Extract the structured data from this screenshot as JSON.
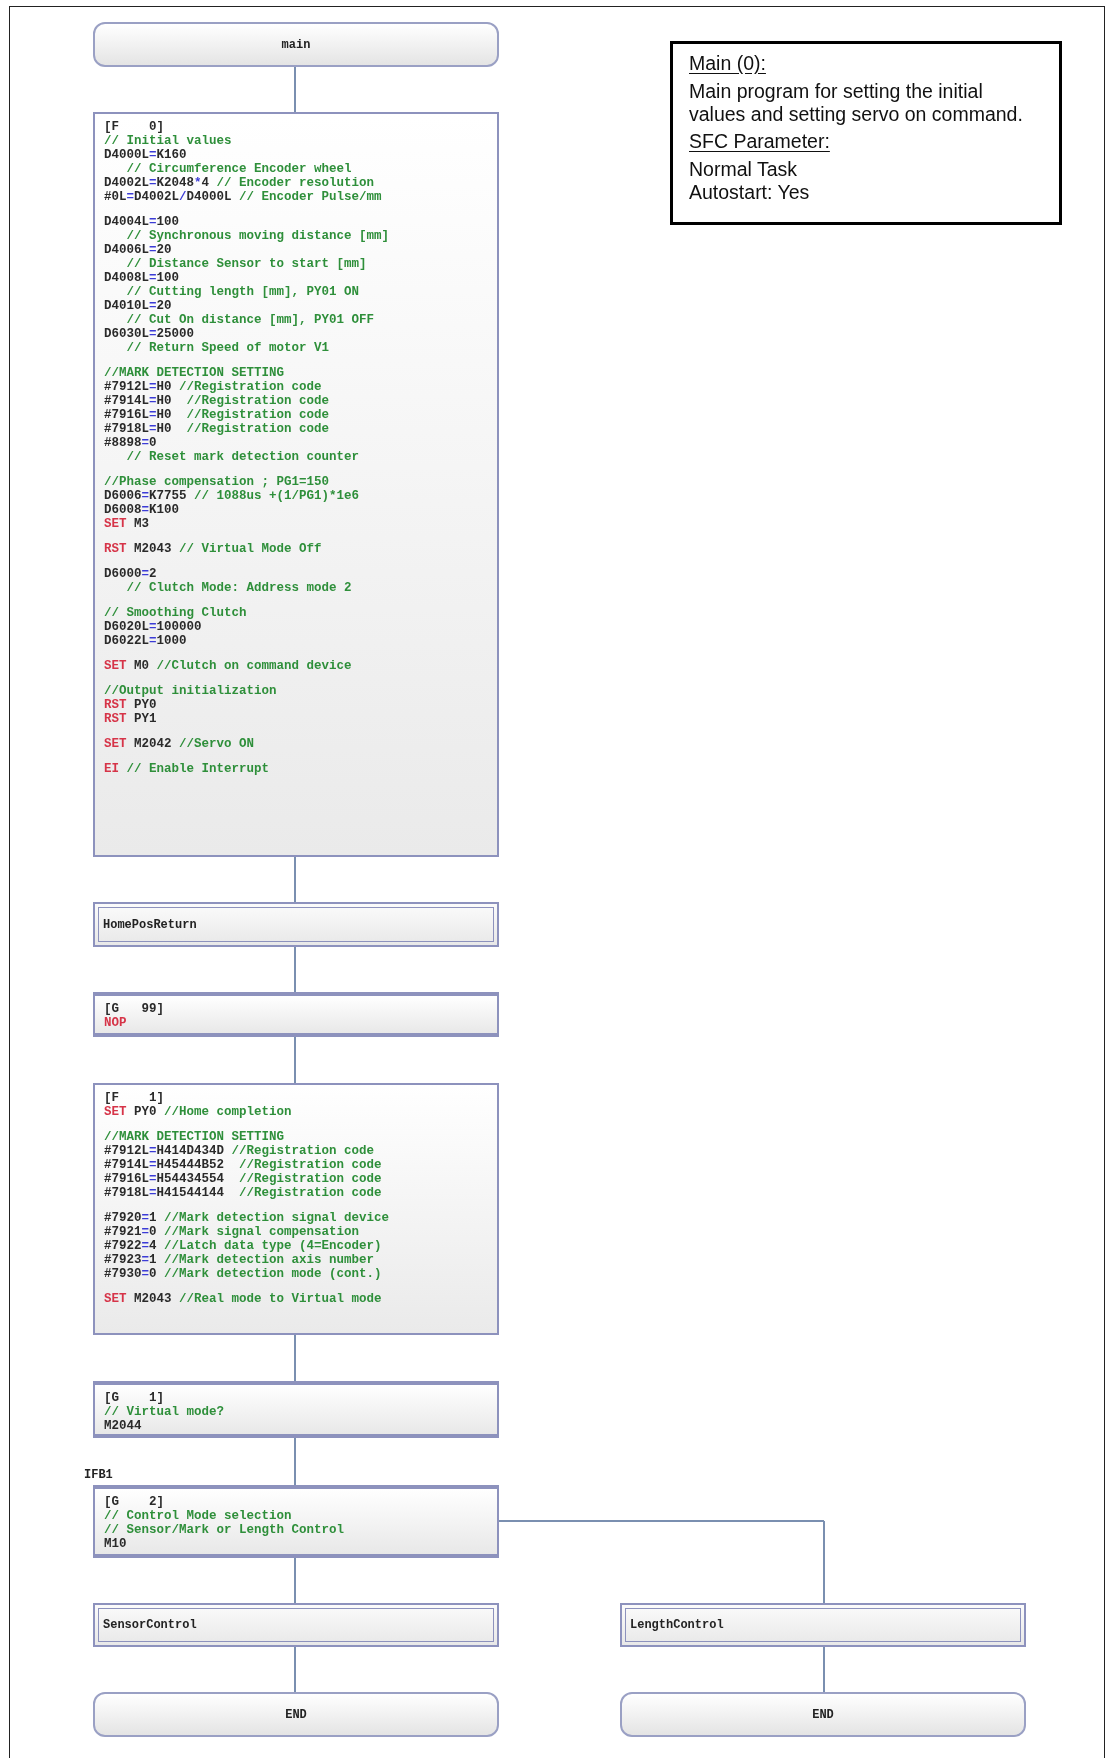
{
  "note": {
    "heading": "Main (0):",
    "description": "Main program for setting the initial values and setting servo on command.",
    "param_heading": "SFC Parameter:",
    "params": [
      "Normal Task",
      "Autostart: Yes"
    ]
  },
  "main_flow": [
    {
      "kind": "terminal",
      "label": "main"
    },
    {
      "kind": "block",
      "paragraphs": [
        [
          [
            {
              "kind": "device",
              "text": "[F    0]"
            }
          ],
          [
            {
              "kind": "comment",
              "text": "// Initial values"
            }
          ],
          [
            {
              "kind": "device",
              "text": "D4000L"
            },
            {
              "kind": "operator",
              "text": "="
            },
            {
              "kind": "device",
              "text": "K160"
            }
          ],
          [
            {
              "kind": "comment",
              "text": "   // Circumference Encoder wheel"
            }
          ],
          [
            {
              "kind": "device",
              "text": "D4002L"
            },
            {
              "kind": "operator",
              "text": "="
            },
            {
              "kind": "device",
              "text": "K2048"
            },
            {
              "kind": "operator",
              "text": "*"
            },
            {
              "kind": "device",
              "text": "4 "
            },
            {
              "kind": "comment",
              "text": "// Encoder resolution"
            }
          ],
          [
            {
              "kind": "device",
              "text": "#0L"
            },
            {
              "kind": "operator",
              "text": "="
            },
            {
              "kind": "device",
              "text": "D4002L"
            },
            {
              "kind": "operator",
              "text": "/"
            },
            {
              "kind": "device",
              "text": "D4000L "
            },
            {
              "kind": "comment",
              "text": "// Encoder Pulse/mm"
            }
          ]
        ],
        [
          [
            {
              "kind": "device",
              "text": "D4004L"
            },
            {
              "kind": "operator",
              "text": "="
            },
            {
              "kind": "device",
              "text": "100"
            }
          ],
          [
            {
              "kind": "comment",
              "text": "   // Synchronous moving distance [mm]"
            }
          ],
          [
            {
              "kind": "device",
              "text": "D4006L"
            },
            {
              "kind": "operator",
              "text": "="
            },
            {
              "kind": "device",
              "text": "20"
            }
          ],
          [
            {
              "kind": "comment",
              "text": "   // Distance Sensor to start [mm]"
            }
          ],
          [
            {
              "kind": "device",
              "text": "D4008L"
            },
            {
              "kind": "operator",
              "text": "="
            },
            {
              "kind": "device",
              "text": "100"
            }
          ],
          [
            {
              "kind": "comment",
              "text": "   // Cutting length [mm], PY01 ON"
            }
          ],
          [
            {
              "kind": "device",
              "text": "D4010L"
            },
            {
              "kind": "operator",
              "text": "="
            },
            {
              "kind": "device",
              "text": "20"
            }
          ],
          [
            {
              "kind": "comment",
              "text": "   // Cut On distance [mm], PY01 OFF"
            }
          ],
          [
            {
              "kind": "device",
              "text": "D6030L"
            },
            {
              "kind": "operator",
              "text": "="
            },
            {
              "kind": "device",
              "text": "25000"
            }
          ],
          [
            {
              "kind": "comment",
              "text": "   // Return Speed of motor V1"
            }
          ]
        ],
        [
          [
            {
              "kind": "comment",
              "text": "//MARK DETECTION SETTING"
            }
          ],
          [
            {
              "kind": "device",
              "text": "#7912L"
            },
            {
              "kind": "operator",
              "text": "="
            },
            {
              "kind": "device",
              "text": "H0 "
            },
            {
              "kind": "comment",
              "text": "//Registration code"
            }
          ],
          [
            {
              "kind": "device",
              "text": "#7914L"
            },
            {
              "kind": "operator",
              "text": "="
            },
            {
              "kind": "device",
              "text": "H0  "
            },
            {
              "kind": "comment",
              "text": "//Registration code"
            }
          ],
          [
            {
              "kind": "device",
              "text": "#7916L"
            },
            {
              "kind": "operator",
              "text": "="
            },
            {
              "kind": "device",
              "text": "H0  "
            },
            {
              "kind": "comment",
              "text": "//Registration code"
            }
          ],
          [
            {
              "kind": "device",
              "text": "#7918L"
            },
            {
              "kind": "operator",
              "text": "="
            },
            {
              "kind": "device",
              "text": "H0  "
            },
            {
              "kind": "comment",
              "text": "//Registration code"
            }
          ],
          [
            {
              "kind": "device",
              "text": "#8898"
            },
            {
              "kind": "operator",
              "text": "="
            },
            {
              "kind": "device",
              "text": "0"
            }
          ],
          [
            {
              "kind": "comment",
              "text": "   // Reset mark detection counter"
            }
          ]
        ],
        [
          [
            {
              "kind": "comment",
              "text": "//Phase compensation ; PG1=150"
            }
          ],
          [
            {
              "kind": "device",
              "text": "D6006"
            },
            {
              "kind": "operator",
              "text": "="
            },
            {
              "kind": "device",
              "text": "K7755 "
            },
            {
              "kind": "comment",
              "text": "// 1088us +(1/PG1)*1e6"
            }
          ],
          [
            {
              "kind": "device",
              "text": "D6008"
            },
            {
              "kind": "operator",
              "text": "="
            },
            {
              "kind": "device",
              "text": "K100"
            }
          ],
          [
            {
              "kind": "keyword",
              "text": "SET "
            },
            {
              "kind": "device",
              "text": "M3"
            }
          ]
        ],
        [
          [
            {
              "kind": "keyword",
              "text": "RST "
            },
            {
              "kind": "device",
              "text": "M2043 "
            },
            {
              "kind": "comment",
              "text": "// Virtual Mode Off"
            }
          ]
        ],
        [
          [
            {
              "kind": "device",
              "text": "D6000"
            },
            {
              "kind": "operator",
              "text": "="
            },
            {
              "kind": "device",
              "text": "2"
            }
          ],
          [
            {
              "kind": "comment",
              "text": "   // Clutch Mode: Address mode 2"
            }
          ]
        ],
        [
          [
            {
              "kind": "comment",
              "text": "// Smoothing Clutch"
            }
          ],
          [
            {
              "kind": "device",
              "text": "D6020L"
            },
            {
              "kind": "operator",
              "text": "="
            },
            {
              "kind": "device",
              "text": "100000"
            }
          ],
          [
            {
              "kind": "device",
              "text": "D6022L"
            },
            {
              "kind": "operator",
              "text": "="
            },
            {
              "kind": "device",
              "text": "1000"
            }
          ]
        ],
        [
          [
            {
              "kind": "keyword",
              "text": "SET "
            },
            {
              "kind": "device",
              "text": "M0 "
            },
            {
              "kind": "comment",
              "text": "//Clutch on command device"
            }
          ]
        ],
        [
          [
            {
              "kind": "comment",
              "text": "//Output initialization"
            }
          ],
          [
            {
              "kind": "keyword",
              "text": "RST "
            },
            {
              "kind": "device",
              "text": "PY0"
            }
          ],
          [
            {
              "kind": "keyword",
              "text": "RST "
            },
            {
              "kind": "device",
              "text": "PY1"
            }
          ]
        ],
        [
          [
            {
              "kind": "keyword",
              "text": "SET "
            },
            {
              "kind": "device",
              "text": "M2042 "
            },
            {
              "kind": "comment",
              "text": "//Servo ON"
            }
          ]
        ],
        [
          [
            {
              "kind": "keyword",
              "text": "EI "
            },
            {
              "kind": "comment",
              "text": "// Enable Interrupt"
            }
          ]
        ]
      ]
    },
    {
      "kind": "call",
      "label": "HomePosReturn"
    },
    {
      "kind": "transition",
      "paragraphs": [
        [
          [
            {
              "kind": "device",
              "text": "[G   99]"
            }
          ],
          [
            {
              "kind": "keyword",
              "text": "NOP"
            }
          ]
        ]
      ]
    },
    {
      "kind": "block",
      "paragraphs": [
        [
          [
            {
              "kind": "device",
              "text": "[F    1]"
            }
          ],
          [
            {
              "kind": "keyword",
              "text": "SET "
            },
            {
              "kind": "device",
              "text": "PY0 "
            },
            {
              "kind": "comment",
              "text": "//Home completion"
            }
          ]
        ],
        [
          [
            {
              "kind": "comment",
              "text": "//MARK DETECTION SETTING"
            }
          ],
          [
            {
              "kind": "device",
              "text": "#7912L"
            },
            {
              "kind": "operator",
              "text": "="
            },
            {
              "kind": "device",
              "text": "H414D434D "
            },
            {
              "kind": "comment",
              "text": "//Registration code"
            }
          ],
          [
            {
              "kind": "device",
              "text": "#7914L"
            },
            {
              "kind": "operator",
              "text": "="
            },
            {
              "kind": "device",
              "text": "H45444B52  "
            },
            {
              "kind": "comment",
              "text": "//Registration code"
            }
          ],
          [
            {
              "kind": "device",
              "text": "#7916L"
            },
            {
              "kind": "operator",
              "text": "="
            },
            {
              "kind": "device",
              "text": "H54434554  "
            },
            {
              "kind": "comment",
              "text": "//Registration code"
            }
          ],
          [
            {
              "kind": "device",
              "text": "#7918L"
            },
            {
              "kind": "operator",
              "text": "="
            },
            {
              "kind": "device",
              "text": "H41544144  "
            },
            {
              "kind": "comment",
              "text": "//Registration code"
            }
          ]
        ],
        [
          [
            {
              "kind": "device",
              "text": "#7920"
            },
            {
              "kind": "operator",
              "text": "="
            },
            {
              "kind": "device",
              "text": "1 "
            },
            {
              "kind": "comment",
              "text": "//Mark detection signal device"
            }
          ],
          [
            {
              "kind": "device",
              "text": "#7921"
            },
            {
              "kind": "operator",
              "text": "="
            },
            {
              "kind": "device",
              "text": "0 "
            },
            {
              "kind": "comment",
              "text": "//Mark signal compensation"
            }
          ],
          [
            {
              "kind": "device",
              "text": "#7922"
            },
            {
              "kind": "operator",
              "text": "="
            },
            {
              "kind": "device",
              "text": "4 "
            },
            {
              "kind": "comment",
              "text": "//Latch data type (4=Encoder)"
            }
          ],
          [
            {
              "kind": "device",
              "text": "#7923"
            },
            {
              "kind": "operator",
              "text": "="
            },
            {
              "kind": "device",
              "text": "1 "
            },
            {
              "kind": "comment",
              "text": "//Mark detection axis number"
            }
          ],
          [
            {
              "kind": "device",
              "text": "#7930"
            },
            {
              "kind": "operator",
              "text": "="
            },
            {
              "kind": "device",
              "text": "0 "
            },
            {
              "kind": "comment",
              "text": "//Mark detection mode (cont.)"
            }
          ]
        ],
        [
          [
            {
              "kind": "keyword",
              "text": "SET "
            },
            {
              "kind": "device",
              "text": "M2043 "
            },
            {
              "kind": "comment",
              "text": "//Real mode to Virtual mode"
            }
          ]
        ]
      ]
    },
    {
      "kind": "transition",
      "paragraphs": [
        [
          [
            {
              "kind": "device",
              "text": "[G    1]"
            }
          ],
          [
            {
              "kind": "comment",
              "text": "// Virtual mode?"
            }
          ],
          [
            {
              "kind": "device",
              "text": "M2044"
            }
          ]
        ]
      ]
    },
    {
      "kind": "transition",
      "tag": "IFB1",
      "paragraphs": [
        [
          [
            {
              "kind": "device",
              "text": "[G    2]"
            }
          ],
          [
            {
              "kind": "comment",
              "text": "// Control Mode selection"
            }
          ],
          [
            {
              "kind": "comment",
              "text": "// Sensor/Mark or Length Control"
            }
          ],
          [
            {
              "kind": "device",
              "text": "M10"
            }
          ]
        ]
      ]
    },
    {
      "kind": "call",
      "label": "SensorControl"
    },
    {
      "kind": "terminal",
      "label": "END"
    }
  ],
  "branch_flow": [
    {
      "kind": "call",
      "label": "LengthControl"
    },
    {
      "kind": "terminal",
      "label": "END"
    }
  ]
}
